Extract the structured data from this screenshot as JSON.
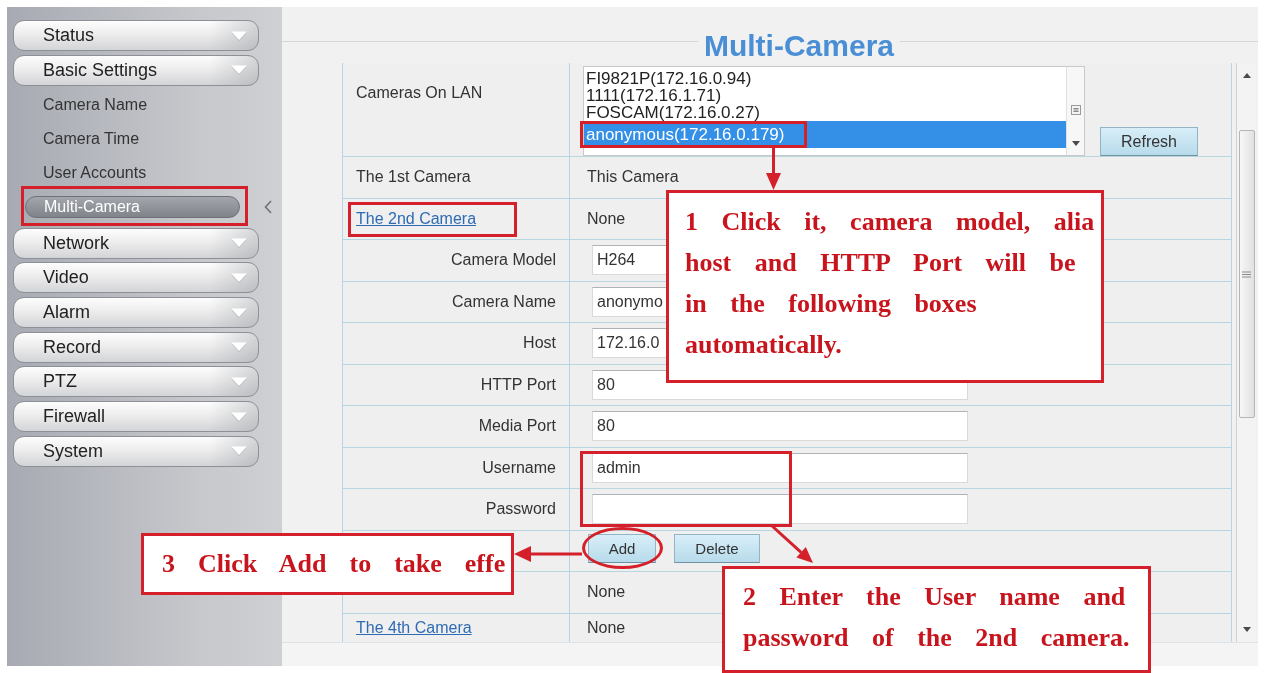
{
  "sidebar": {
    "items": [
      {
        "label": "Status"
      },
      {
        "label": "Basic Settings",
        "children": [
          {
            "label": "Camera Name",
            "selected": false
          },
          {
            "label": "Camera Time",
            "selected": false
          },
          {
            "label": "User Accounts",
            "selected": false
          },
          {
            "label": "Multi-Camera",
            "selected": true
          }
        ]
      },
      {
        "label": "Network"
      },
      {
        "label": "Video"
      },
      {
        "label": "Alarm"
      },
      {
        "label": "Record"
      },
      {
        "label": "PTZ"
      },
      {
        "label": "Firewall"
      },
      {
        "label": "System"
      }
    ]
  },
  "page": {
    "title": "Multi-Camera"
  },
  "form": {
    "rows": [
      {
        "kind": "listbox",
        "label": "Cameras On LAN",
        "options": [
          {
            "label": "FI9821P(172.16.0.94)",
            "selected": false
          },
          {
            "label": "1111(172.16.1.71)",
            "selected": false
          },
          {
            "label": "FOSCAM(172.16.0.27)",
            "selected": false
          },
          {
            "label": "anonymous(172.16.0.179)",
            "selected": true
          }
        ],
        "button": "Refresh"
      },
      {
        "kind": "text",
        "label": "The 1st Camera",
        "value": "This Camera"
      },
      {
        "kind": "link",
        "label": "The 2nd Camera",
        "value": "None"
      },
      {
        "kind": "input",
        "label": "Camera Model",
        "value": "H264"
      },
      {
        "kind": "input",
        "label": "Camera Name",
        "value": "anonymo"
      },
      {
        "kind": "input",
        "label": "Host",
        "value": "172.16.0"
      },
      {
        "kind": "input",
        "label": "HTTP Port",
        "value": "80"
      },
      {
        "kind": "input",
        "label": "Media Port",
        "value": "80"
      },
      {
        "kind": "input",
        "label": "Username",
        "value": "admin"
      },
      {
        "kind": "input",
        "label": "Password"
      },
      {
        "kind": "buttons",
        "buttons": [
          "Add",
          "Delete"
        ]
      },
      {
        "kind": "link",
        "value": "None"
      },
      {
        "kind": "link",
        "label": "The 4th Camera",
        "value": "None"
      }
    ]
  },
  "callouts": [
    {
      "lines": [
        "1 Click it, camera model, alia",
        "host and HTTP Port will be",
        "in the following boxes",
        "automatically."
      ]
    },
    {
      "lines": [
        "2 Enter the User name and",
        "password of the 2nd camera."
      ]
    },
    {
      "lines": [
        "3 Click Add to take effe"
      ]
    }
  ]
}
